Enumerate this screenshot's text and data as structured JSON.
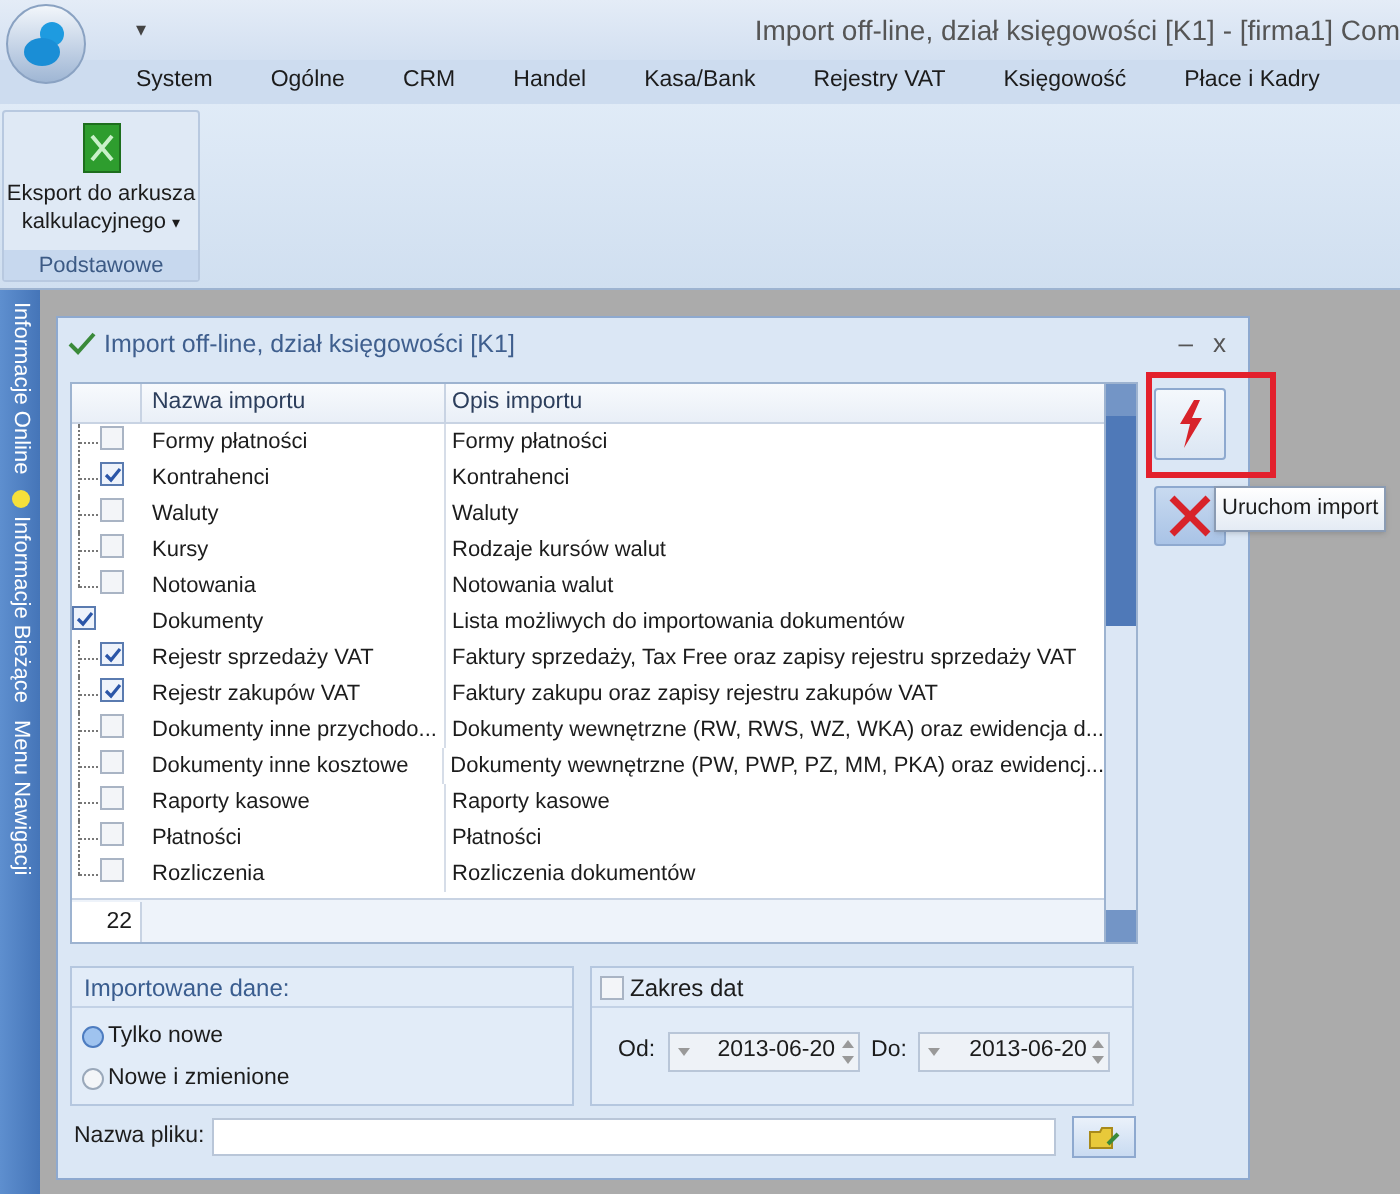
{
  "app": {
    "title": "Import off-line, dział księgowości [K1] - [firma1] Com",
    "quick_access": "▾"
  },
  "menu": [
    {
      "label": "System"
    },
    {
      "label": "Ogólne"
    },
    {
      "label": "CRM"
    },
    {
      "label": "Handel"
    },
    {
      "label": "Kasa/Bank"
    },
    {
      "label": "Rejestry VAT"
    },
    {
      "label": "Księgowość"
    },
    {
      "label": "Płace i Kadry"
    }
  ],
  "ribbon": {
    "button": {
      "line1": "Eksport do arkusza",
      "line2": "kalkulacyjnego",
      "caret": "▾"
    },
    "group": "Podstawowe"
  },
  "sidebar": [
    {
      "label": "Informacje Online",
      "dot": false
    },
    {
      "label": "Informacje Bieżące",
      "dot": true
    },
    {
      "label": "Menu Nawigacji",
      "dot": false
    }
  ],
  "dialog": {
    "title": "Import off-line, dział księgowości [K1]",
    "minimize": "–",
    "close": "x",
    "table": {
      "columns": [
        "Nazwa importu",
        "Opis importu"
      ],
      "rows": [
        {
          "children": [
            {
              "name": "Formy płatności",
              "description": "Formy płatności",
              "checked": false
            },
            {
              "name": "Kontrahenci",
              "description": "Kontrahenci",
              "checked": true
            },
            {
              "name": "Waluty",
              "description": "Waluty",
              "checked": false
            },
            {
              "name": "Kursy",
              "description": "Rodzaje kursów walut",
              "checked": false
            },
            {
              "name": "Notowania",
              "description": "Notowania walut",
              "checked": false
            }
          ]
        },
        {
          "name": "Dokumenty",
          "description": "Lista możliwych do importowania dokumentów",
          "checked": true,
          "children": [
            {
              "name": "Rejestr sprzedaży VAT",
              "description": "Faktury sprzedaży, Tax Free oraz zapisy rejestru sprzedaży VAT",
              "checked": true
            },
            {
              "name": "Rejestr zakupów VAT",
              "description": "Faktury zakupu oraz zapisy rejestru zakupów VAT",
              "checked": true
            },
            {
              "name": "Dokumenty inne przychodo...",
              "description": "Dokumenty wewnętrzne (RW, RWS, WZ, WKA) oraz ewidencja d...",
              "checked": false
            },
            {
              "name": "Dokumenty inne kosztowe",
              "description": "Dokumenty wewnętrzne (PW, PWP, PZ, MM, PKA) oraz ewidencj...",
              "checked": false
            },
            {
              "name": "Raporty kasowe",
              "description": "Raporty kasowe",
              "checked": false
            },
            {
              "name": "Płatności",
              "description": "Płatności",
              "checked": false
            },
            {
              "name": "Rozliczenia",
              "description": "Rozliczenia dokumentów",
              "checked": false
            }
          ]
        }
      ],
      "count": "22"
    },
    "tooltip": "Uruchom import",
    "imported": {
      "title": "Importowane dane:",
      "options": [
        {
          "label": "Tylko nowe",
          "selected": true
        },
        {
          "label": "Nowe i zmienione",
          "selected": false
        }
      ]
    },
    "date_range": {
      "label": "Zakres dat",
      "checked": false,
      "from_label": "Od:",
      "from": "2013-06-20",
      "to_label": "Do:",
      "to": "2013-06-20"
    },
    "file": {
      "label": "Nazwa pliku:"
    }
  }
}
